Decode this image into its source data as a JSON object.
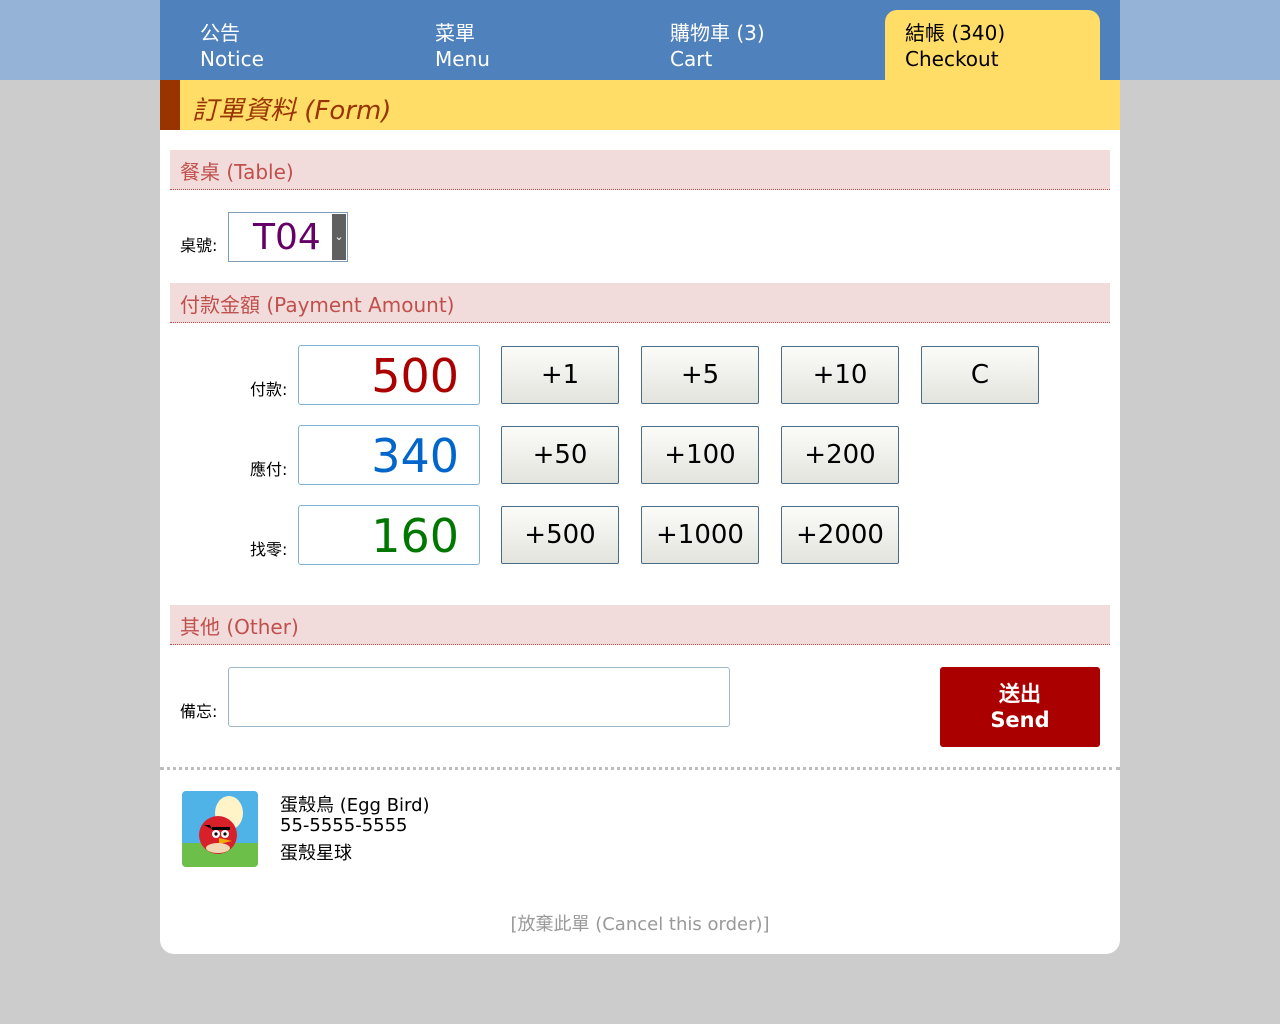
{
  "nav": {
    "tabs": [
      {
        "zh": "公告",
        "en": "Notice"
      },
      {
        "zh": "菜單",
        "en": "Menu"
      },
      {
        "zh": "購物車 (3)",
        "en": "Cart"
      },
      {
        "zh": "結帳 (340)",
        "en": "Checkout"
      }
    ],
    "active_tab": "Checkout",
    "bar_color": "#4f81bd",
    "active_color": "#ffdd66"
  },
  "page_title": "訂單資料 (Form)",
  "sections": {
    "table": {
      "heading": "餐桌 (Table)",
      "label": "桌號:",
      "selected": "T04"
    },
    "payment": {
      "heading": "付款金額 (Payment Amount)",
      "paid_label": "付款:",
      "paid_value": "500",
      "due_label": "應付:",
      "due_value": "340",
      "change_label": "找零:",
      "change_value": "160",
      "buttons": [
        "+1",
        "+5",
        "+10",
        "C",
        "+50",
        "+100",
        "+200",
        "+500",
        "+1000",
        "+2000"
      ]
    },
    "other": {
      "heading": "其他 (Other)",
      "memo_label": "備忘:",
      "memo_value": "",
      "send_zh": "送出",
      "send_en": "Send"
    }
  },
  "shop": {
    "name": "蛋殼鳥 (Egg Bird)",
    "phone": "55-5555-5555",
    "address": "蛋殼星球"
  },
  "cancel_link": "[放棄此單 (Cancel this order)]",
  "colors": {
    "paid": "#aa0000",
    "due": "#0066cc",
    "change": "#007700",
    "send": "#aa0000",
    "section_bg": "#f2dcdb",
    "section_text": "#c0504d"
  }
}
